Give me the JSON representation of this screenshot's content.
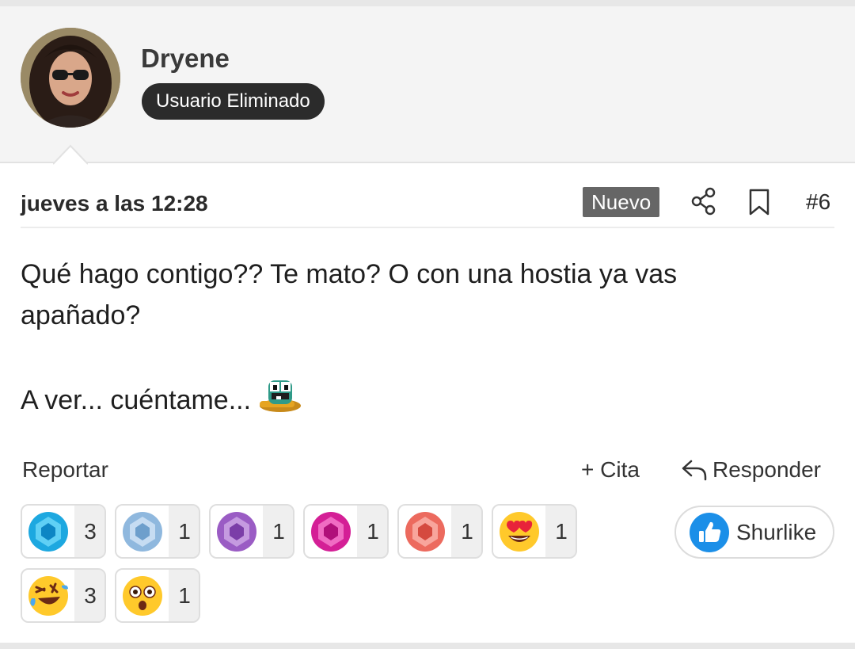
{
  "user": {
    "name": "Dryene",
    "badge": "Usuario Eliminado",
    "avatar": "avatar-woman-sunglasses"
  },
  "post": {
    "date": "jueves a las 12:28",
    "new_label": "Nuevo",
    "number": "#6",
    "body_lines": [
      "Qué hago contigo?? Te mato? O con una hostia ya vas",
      "apañado?",
      "",
      "A ver... cuéntame..."
    ],
    "inline_emoji": "duck-emoji"
  },
  "actions": {
    "report": "Reportar",
    "cite": "+ Cita",
    "reply": "Responder"
  },
  "reactions": [
    {
      "icon": "blue-gem-icon",
      "count": "3"
    },
    {
      "icon": "light-blue-gem-icon",
      "count": "1"
    },
    {
      "icon": "purple-gem-icon",
      "count": "1"
    },
    {
      "icon": "pink-gem-icon",
      "count": "1"
    },
    {
      "icon": "red-gem-icon",
      "count": "1"
    },
    {
      "icon": "heart-eyes-icon",
      "count": "1"
    },
    {
      "icon": "laughing-icon",
      "count": "3"
    },
    {
      "icon": "flushed-face-icon",
      "count": "1"
    }
  ],
  "shurlike": {
    "label": "Shurlike",
    "icon": "thumbs-up-icon"
  },
  "colors": {
    "header_bg": "#f4f4f4",
    "badge_bg": "#2b2b2b",
    "new_badge_bg": "#666666",
    "like_blue": "#1b8fe8"
  }
}
